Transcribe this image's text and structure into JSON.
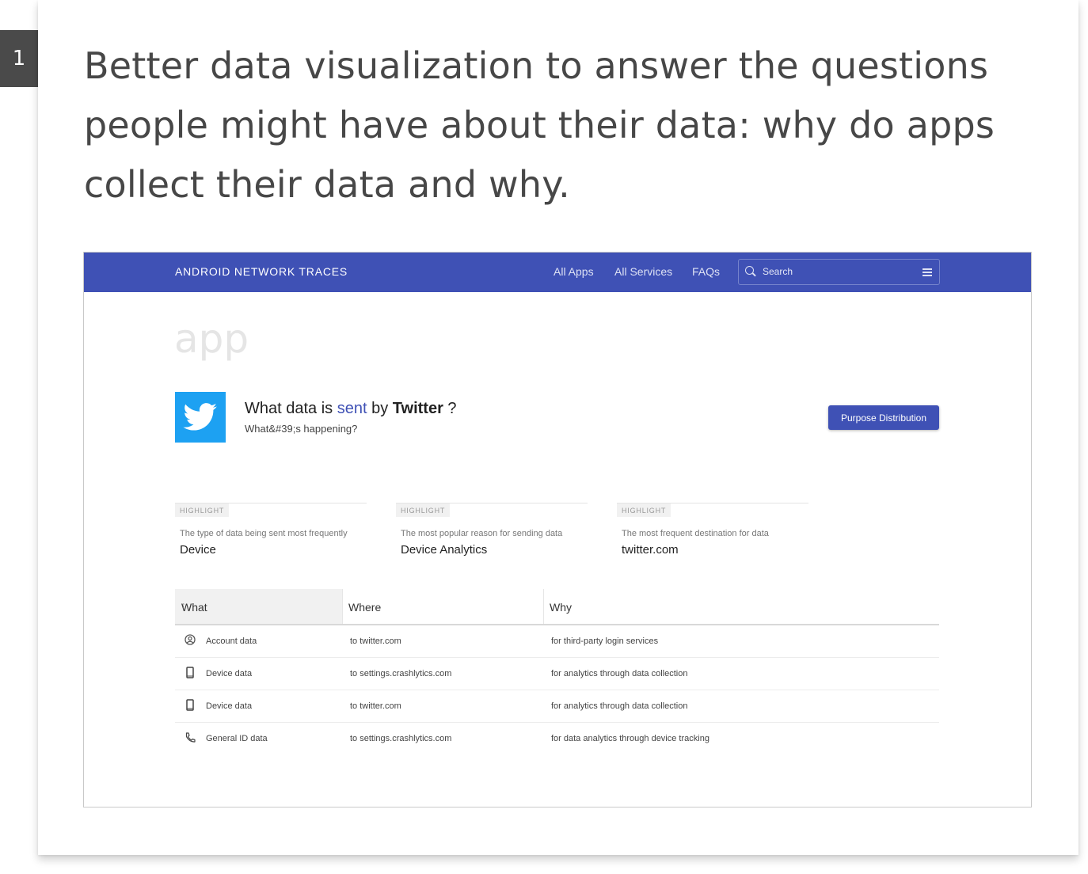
{
  "slide": {
    "number": "1",
    "heading": "Better data visualization to answer the questions people might have about their data: why do apps collect their data and why."
  },
  "app": {
    "navbar": {
      "brand": "ANDROID NETWORK TRACES",
      "links": [
        "All Apps",
        "All Services",
        "FAQs"
      ],
      "search_placeholder": "Search"
    },
    "watermark": "app",
    "header": {
      "prefix": "What data is ",
      "sent": "sent",
      "by": " by ",
      "app_name": "Twitter",
      "suffix": " ?",
      "subtitle": "What&#39;s happening?"
    },
    "purpose_button": "Purpose Distribution",
    "highlights": [
      {
        "badge": "HIGHLIGHT",
        "desc": "The type of data being sent most frequently",
        "value": "Device"
      },
      {
        "badge": "HIGHLIGHT",
        "desc": "The most popular reason for sending data",
        "value": "Device Analytics"
      },
      {
        "badge": "HIGHLIGHT",
        "desc": "The most frequent destination for data",
        "value": "twitter.com"
      }
    ],
    "table": {
      "columns": [
        "What",
        "Where",
        "Why"
      ],
      "sort_icon": "arrow-up-icon",
      "rows": [
        {
          "icon": "account-circle-icon",
          "what": "Account data",
          "where": "to twitter.com",
          "why": "for third-party login services"
        },
        {
          "icon": "phone-device-icon",
          "what": "Device data",
          "where": "to settings.crashlytics.com",
          "why": "for analytics through data collection"
        },
        {
          "icon": "phone-device-icon",
          "what": "Device data",
          "where": "to twitter.com",
          "why": "for analytics through data collection"
        },
        {
          "icon": "telephone-handset-icon",
          "what": "General ID data",
          "where": "to settings.crashlytics.com",
          "why": "for data analytics through device tracking"
        }
      ]
    }
  },
  "colors": {
    "brand_blue": "#3f51b5",
    "twitter_blue": "#1da1f2",
    "heading_gray": "#474747"
  }
}
